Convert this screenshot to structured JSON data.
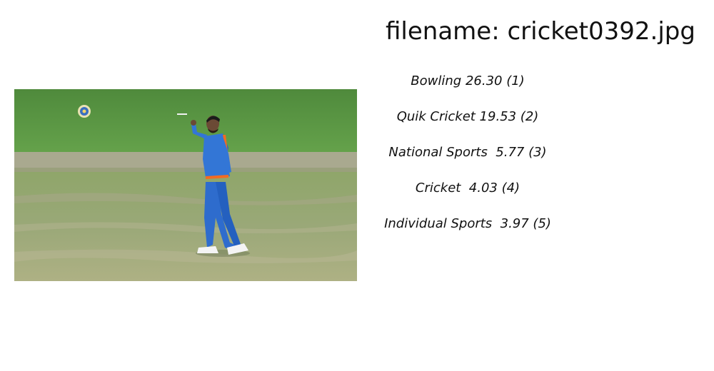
{
  "header": {
    "filename_label": "filename: cricket0392.jpg"
  },
  "image": {
    "subject": "cricket-photo",
    "colors": {
      "outfield": "#5e9a46",
      "pitch": "#a8a98e",
      "jersey": "#2f6fd0",
      "accent": "#f26b22"
    }
  },
  "predictions": [
    {
      "text": "Bowling 26.30 (1)"
    },
    {
      "text": "Quik Cricket 19.53 (2)"
    },
    {
      "text": "National Sports  5.77 (3)"
    },
    {
      "text": "Cricket  4.03 (4)"
    },
    {
      "text": "Individual Sports  3.97 (5)"
    }
  ]
}
